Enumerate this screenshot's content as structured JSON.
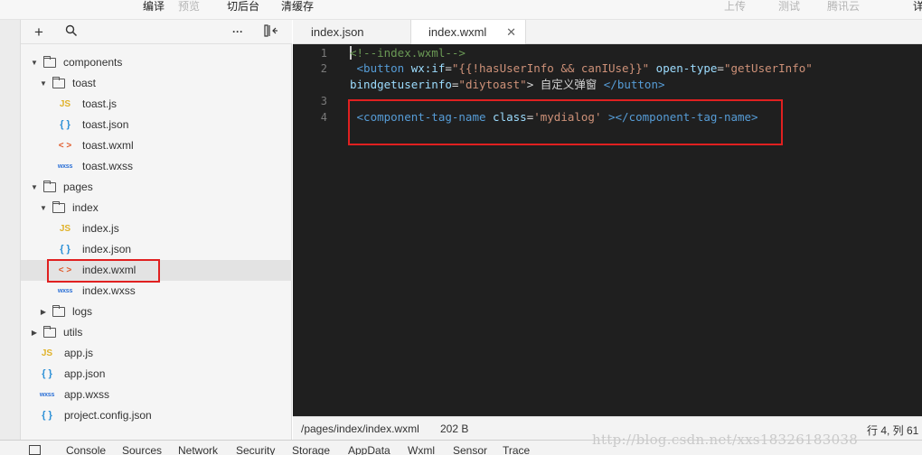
{
  "topbar": {
    "compile": "编译",
    "preview": "预览",
    "background": "切后台",
    "clear_cache": "清缓存",
    "upload": "上传",
    "test": "测试",
    "tencent_cloud": "腾讯云",
    "details": "详"
  },
  "sidebar": {
    "toolbar_icons": [
      "plus-icon",
      "search-icon",
      "more-icon",
      "collapse-panel-icon"
    ],
    "plus_glyph": "+",
    "more_glyph": "···",
    "tree": [
      {
        "label": "components",
        "type": "folder",
        "expanded": true,
        "depth": 0
      },
      {
        "label": "toast",
        "type": "folder",
        "expanded": true,
        "depth": 1
      },
      {
        "label": "toast.js",
        "type": "js",
        "icon_text": "JS",
        "depth": 2
      },
      {
        "label": "toast.json",
        "type": "json",
        "icon_text": "{ }",
        "depth": 2
      },
      {
        "label": "toast.wxml",
        "type": "wxml",
        "icon_text": "< >",
        "depth": 2
      },
      {
        "label": "toast.wxss",
        "type": "wxss",
        "icon_text": "wxss",
        "depth": 2
      },
      {
        "label": "pages",
        "type": "folder",
        "expanded": true,
        "depth": 0
      },
      {
        "label": "index",
        "type": "folder",
        "expanded": true,
        "depth": 1
      },
      {
        "label": "index.js",
        "type": "js",
        "icon_text": "JS",
        "depth": 2
      },
      {
        "label": "index.json",
        "type": "json",
        "icon_text": "{ }",
        "depth": 2
      },
      {
        "label": "index.wxml",
        "type": "wxml",
        "icon_text": "< >",
        "depth": 2,
        "selected": true
      },
      {
        "label": "index.wxss",
        "type": "wxss",
        "icon_text": "wxss",
        "depth": 2
      },
      {
        "label": "logs",
        "type": "folder",
        "expanded": false,
        "depth": 1
      },
      {
        "label": "utils",
        "type": "folder",
        "expanded": false,
        "depth": 0
      },
      {
        "label": "app.js",
        "type": "js",
        "icon_text": "JS",
        "depth": 0
      },
      {
        "label": "app.json",
        "type": "json",
        "icon_text": "{ }",
        "depth": 0
      },
      {
        "label": "app.wxss",
        "type": "wxss",
        "icon_text": "wxss",
        "depth": 0
      },
      {
        "label": "project.config.json",
        "type": "json",
        "icon_text": "{ }",
        "depth": 0
      }
    ]
  },
  "tabs": [
    {
      "label": "index.json",
      "active": false
    },
    {
      "label": "index.wxml",
      "active": true,
      "close": "✕"
    }
  ],
  "editor": {
    "line_numbers": [
      "1",
      "2",
      "",
      "3",
      "4"
    ],
    "lines": [
      [
        {
          "t": "<!--index.wxml-->",
          "c": "comment"
        }
      ],
      [
        {
          "t": " <button ",
          "c": "tag"
        },
        {
          "t": "wx:if",
          "c": "attr"
        },
        {
          "t": "=",
          "c": "text"
        },
        {
          "t": "\"{{!hasUserInfo && canIUse}}\"",
          "c": "str"
        },
        {
          "t": " open-type",
          "c": "attr"
        },
        {
          "t": "=",
          "c": "text"
        },
        {
          "t": "\"getUserInfo\"",
          "c": "str"
        }
      ],
      [
        {
          "t": "bindgetuserinfo",
          "c": "attr"
        },
        {
          "t": "=",
          "c": "text"
        },
        {
          "t": "\"diytoast\"",
          "c": "str"
        },
        {
          "t": "> 自定义弹窗 ",
          "c": "text"
        },
        {
          "t": "</button>",
          "c": "tag"
        }
      ],
      [
        {
          "t": "",
          "c": "text"
        }
      ],
      [
        {
          "t": " <component-tag-name ",
          "c": "tag"
        },
        {
          "t": "class",
          "c": "attr"
        },
        {
          "t": "=",
          "c": "text"
        },
        {
          "t": "'mydialog'",
          "c": "str"
        },
        {
          "t": " ></component-tag-name>",
          "c": "tag"
        }
      ]
    ]
  },
  "status": {
    "path": "/pages/index/index.wxml",
    "size": "202 B",
    "position": "行 4, 列 61"
  },
  "devtools_tabs": [
    "Console",
    "Sources",
    "Network",
    "Security",
    "Storage",
    "AppData",
    "Wxml",
    "Sensor",
    "Trace"
  ],
  "watermark": "http://blog.csdn.net/xxs18326183038",
  "colors": {
    "highlight_box": "#e02020",
    "editor_bg": "#1f1f1f"
  }
}
